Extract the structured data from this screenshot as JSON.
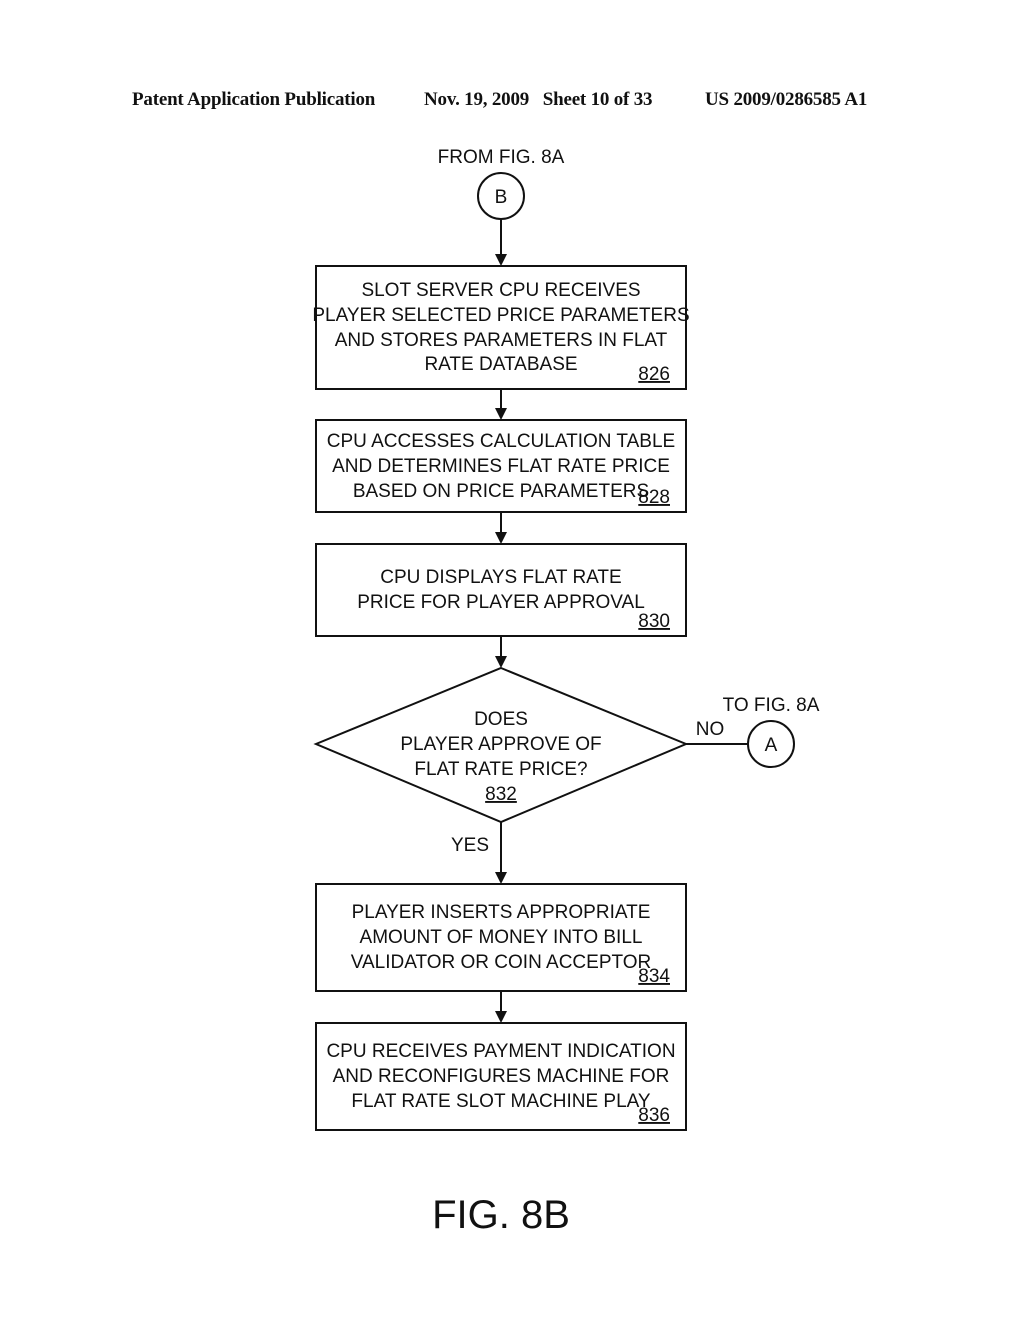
{
  "header": {
    "publication": "Patent Application Publication",
    "date_sheet": "Nov. 19, 2009   Sheet 10 of 33",
    "number": "US 2009/0286585 A1"
  },
  "diagram": {
    "entry_connector": {
      "label": "B",
      "caption": "FROM FIG. 8A"
    },
    "steps": [
      {
        "id": "826",
        "lines": [
          "SLOT SERVER CPU RECEIVES",
          "PLAYER SELECTED PRICE PARAMETERS",
          "AND STORES PARAMETERS IN FLAT",
          "RATE DATABASE"
        ]
      },
      {
        "id": "828",
        "lines": [
          "CPU ACCESSES CALCULATION TABLE",
          "AND DETERMINES FLAT RATE PRICE",
          "BASED ON PRICE PARAMETERS"
        ]
      },
      {
        "id": "830",
        "lines": [
          "CPU DISPLAYS FLAT RATE",
          "PRICE FOR PLAYER APPROVAL"
        ]
      }
    ],
    "decision": {
      "id": "832",
      "lines": [
        "DOES",
        "PLAYER APPROVE OF",
        "FLAT RATE PRICE?"
      ],
      "yes_label": "YES",
      "no_label": "NO"
    },
    "exit_connector": {
      "label": "A",
      "caption": "TO FIG. 8A"
    },
    "steps_after": [
      {
        "id": "834",
        "lines": [
          "PLAYER INSERTS APPROPRIATE",
          "AMOUNT OF MONEY INTO BILL",
          "VALIDATOR OR COIN ACCEPTOR"
        ]
      },
      {
        "id": "836",
        "lines": [
          "CPU RECEIVES PAYMENT INDICATION",
          "AND RECONFIGURES MACHINE FOR",
          "FLAT RATE SLOT MACHINE PLAY"
        ]
      }
    ],
    "figure_label": "FIG. 8B"
  }
}
